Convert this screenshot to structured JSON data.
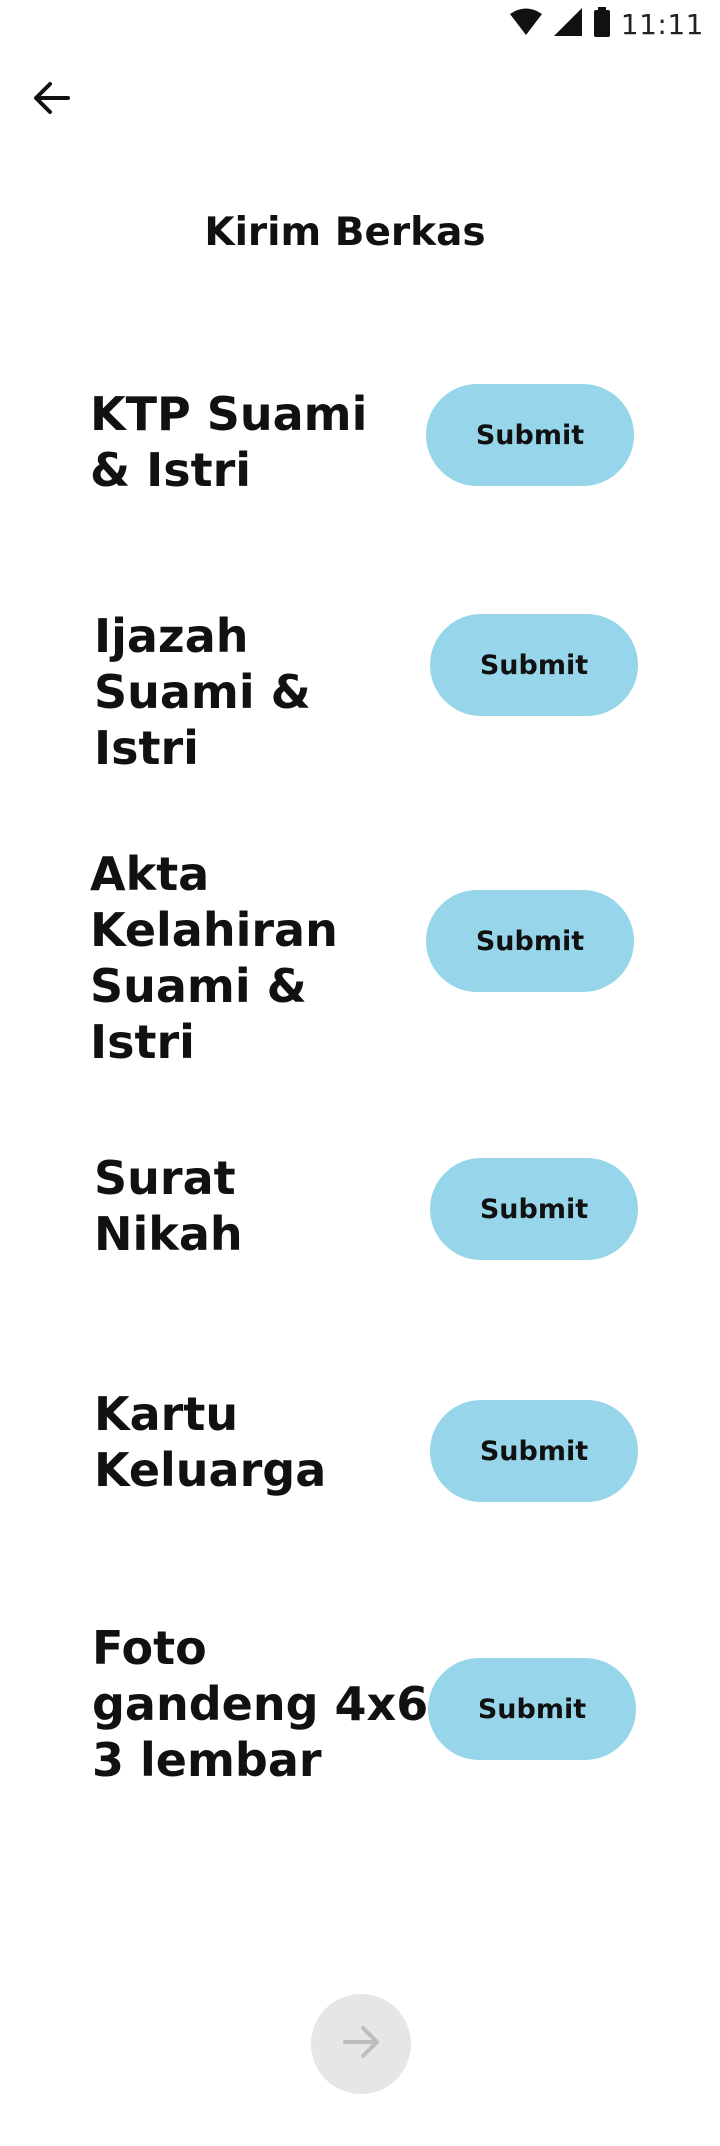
{
  "status_bar": {
    "time": "11:11",
    "icons": [
      "wifi-icon",
      "signal-icon",
      "battery-icon"
    ]
  },
  "header": {
    "back_icon": "arrow-left-icon",
    "title": "Kirim Berkas"
  },
  "documents": [
    {
      "label": "KTP Suami\n& Istri",
      "button_label": "Submit"
    },
    {
      "label": "Ijazah\nSuami &\nIstri",
      "button_label": "Submit"
    },
    {
      "label": "Akta\nKelahiran\nSuami &\nIstri",
      "button_label": "Submit"
    },
    {
      "label": "Surat\nNikah",
      "button_label": "Submit"
    },
    {
      "label": "Kartu\nKeluarga",
      "button_label": "Submit"
    },
    {
      "label": "Foto\ngandeng 4x6\n3 lembar",
      "button_label": "Submit"
    }
  ],
  "footer": {
    "next_icon": "arrow-right-icon"
  },
  "colors": {
    "button_bg": "#97d6ea",
    "fab_bg": "#e6e6e6",
    "fab_icon": "#bdbdbd"
  }
}
